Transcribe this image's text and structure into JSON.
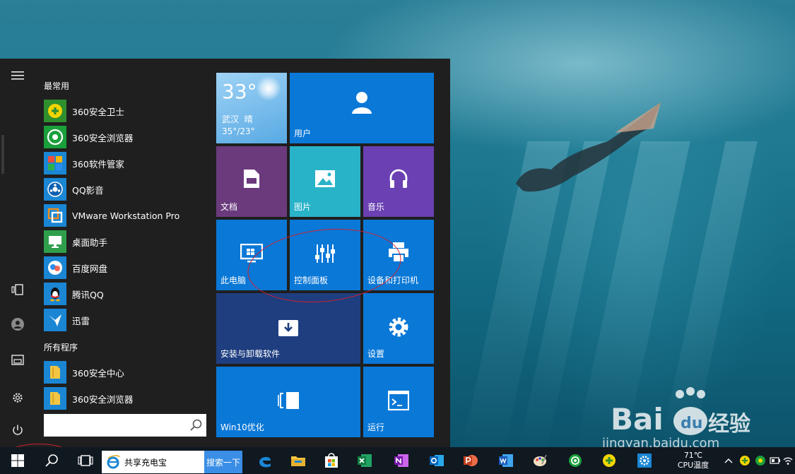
{
  "start_menu": {
    "most_used_header": "最常用",
    "all_programs_header": "所有程序",
    "most_used": [
      {
        "label": "360安全卫士",
        "icon": "360-safeguard-icon"
      },
      {
        "label": "360安全浏览器",
        "icon": "360-browser-icon"
      },
      {
        "label": "360软件管家",
        "icon": "360-software-manager-icon"
      },
      {
        "label": "QQ影音",
        "icon": "qq-player-icon"
      },
      {
        "label": "VMware Workstation Pro",
        "icon": "vmware-icon"
      },
      {
        "label": "桌面助手",
        "icon": "desktop-assistant-icon"
      },
      {
        "label": "百度网盘",
        "icon": "baidu-netdisk-icon"
      },
      {
        "label": "腾讯QQ",
        "icon": "qq-icon"
      },
      {
        "label": "迅雷",
        "icon": "xunlei-icon"
      }
    ],
    "all_programs": [
      {
        "label": "360安全中心",
        "icon": "folder-icon"
      },
      {
        "label": "360安全浏览器",
        "icon": "folder-icon"
      }
    ],
    "search_placeholder": ""
  },
  "tiles": {
    "weather": {
      "temp": "33°",
      "city": "武汉",
      "condition": "晴",
      "range": "35°/23°"
    },
    "user": {
      "label": "用户",
      "icon": "person-icon",
      "color": "#0a78d7"
    },
    "documents": {
      "label": "文档",
      "icon": "document-icon",
      "color": "#6b3a7d"
    },
    "pictures": {
      "label": "图片",
      "icon": "picture-icon",
      "color": "#29b3c9"
    },
    "music": {
      "label": "音乐",
      "icon": "headphones-icon",
      "color": "#6a40b2"
    },
    "this_pc": {
      "label": "此电脑",
      "icon": "monitor-icon",
      "color": "#0a78d7"
    },
    "control_panel": {
      "label": "控制面板",
      "icon": "sliders-icon",
      "color": "#0a78d7"
    },
    "devices_printers": {
      "label": "设备和打印机",
      "icon": "printer-icon",
      "color": "#0a78d7"
    },
    "install_uninstall": {
      "label": "安装与卸载软件",
      "icon": "package-icon",
      "color": "#1e3e80"
    },
    "settings": {
      "label": "设置",
      "icon": "gear-icon",
      "color": "#0a78d7"
    },
    "win10_optimize": {
      "label": "Win10优化",
      "icon": "optimize-icon",
      "color": "#0a78d7"
    },
    "run": {
      "label": "运行",
      "icon": "terminal-icon",
      "color": "#0a78d7"
    }
  },
  "taskbar": {
    "search_text": "共享充电宝",
    "search_button": "搜索一下",
    "cpu_temp": "71℃",
    "cpu_label": "CPU温度"
  },
  "watermark": {
    "brand": "Bai",
    "brand2": "du",
    "brand3": "经验",
    "url": "jingyan.baidu.com"
  }
}
